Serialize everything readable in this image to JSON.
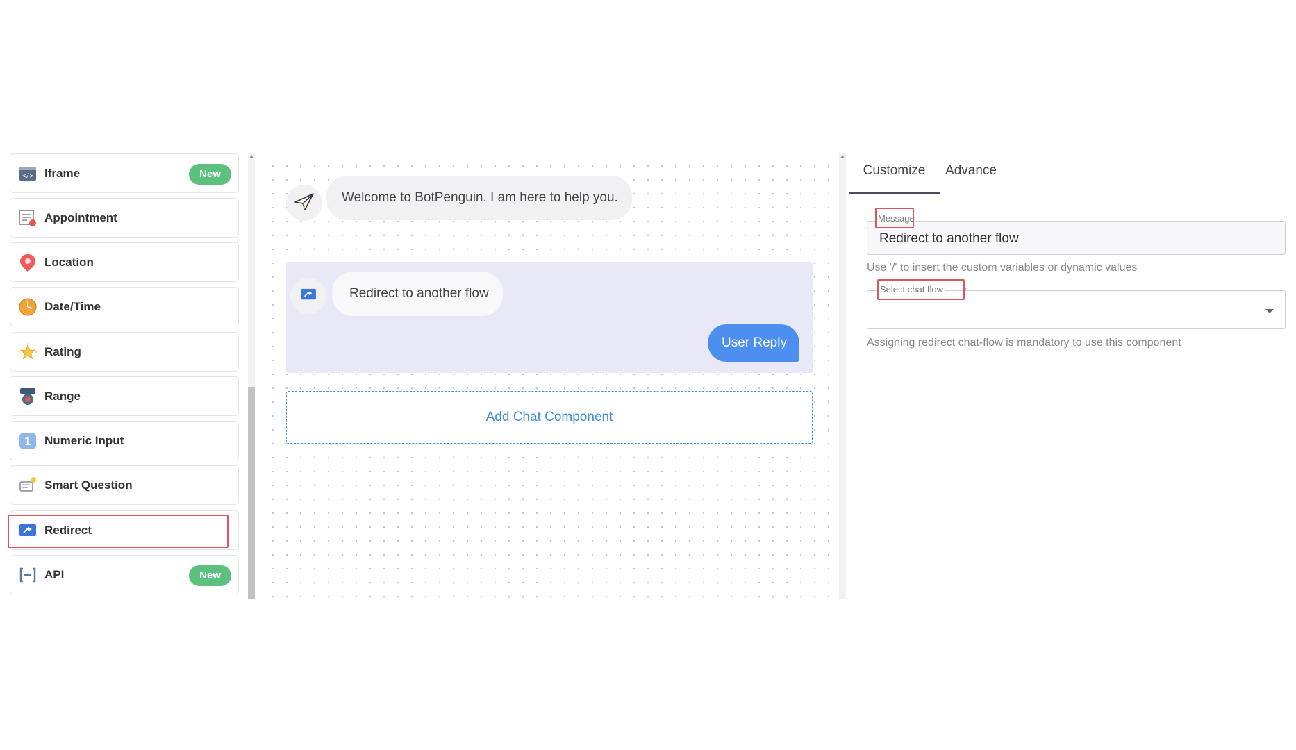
{
  "sidebar": {
    "items": [
      {
        "label": "Iframe",
        "icon": "iframe-icon",
        "badge": "New"
      },
      {
        "label": "Appointment",
        "icon": "appointment-icon",
        "badge": ""
      },
      {
        "label": "Location",
        "icon": "location-pin-icon",
        "badge": ""
      },
      {
        "label": "Date/Time",
        "icon": "clock-icon",
        "badge": ""
      },
      {
        "label": "Rating",
        "icon": "star-icon",
        "badge": ""
      },
      {
        "label": "Range",
        "icon": "range-icon",
        "badge": ""
      },
      {
        "label": "Numeric Input",
        "icon": "numeric-icon",
        "badge": ""
      },
      {
        "label": "Smart Question",
        "icon": "smart-question-icon",
        "badge": ""
      },
      {
        "label": "Redirect",
        "icon": "redirect-icon",
        "badge": "",
        "highlighted": true
      },
      {
        "label": "API",
        "icon": "api-icon",
        "badge": "New"
      }
    ]
  },
  "canvas": {
    "welcome_message": "Welcome to BotPenguin. I am here to help you.",
    "redirect_message": "Redirect to another flow",
    "user_reply_label": "User Reply",
    "add_component_label": "Add Chat Component"
  },
  "panel": {
    "tabs": [
      {
        "label": "Customize",
        "active": true
      },
      {
        "label": "Advance",
        "active": false
      }
    ],
    "message_label": "Message",
    "message_value": "Redirect to another flow",
    "message_hint": "Use '/' to insert the custom variables or dynamic values",
    "chatflow_label": "Select chat flow",
    "chatflow_required": "*",
    "chatflow_value": "",
    "chatflow_hint": "Assigning redirect chat-flow is mandatory to use this component"
  },
  "colors": {
    "badge_green": "#5cc17f",
    "highlight_red": "#e0555d",
    "user_reply_blue": "#4c8ff0",
    "flow_card_bg": "#e9e8f6",
    "add_component_blue": "#3d8fdc"
  }
}
